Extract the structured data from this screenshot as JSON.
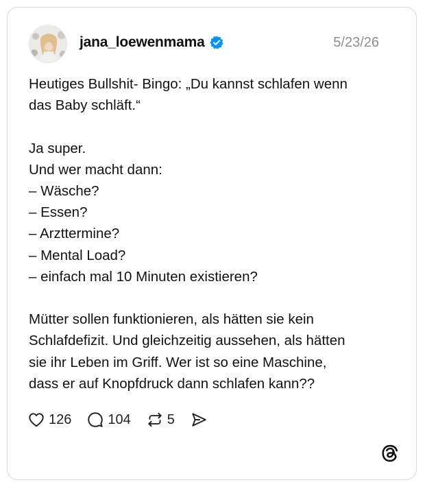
{
  "post": {
    "username": "jana_loewenmama",
    "verified_icon": "verified-badge-icon",
    "timestamp": "5/23/26",
    "lines": [
      "Heutiges Bullshit- Bingo: „Du kannst schlafen wenn",
      "das Baby schläft.“",
      "",
      "Ja super.",
      "Und wer macht dann:",
      "– Wäsche?",
      "– Essen?",
      "– Arzttermine?",
      "– Mental Load?",
      "– einfach mal 10 Minuten existieren?",
      "",
      "Mütter sollen funktionieren, als hätten sie kein",
      "Schlafdefizit. Und gleichzeitig aussehen, als hätten",
      "sie ihr Leben im Griff. Wer ist so eine Maschine,",
      "dass er auf Knopfdruck dann schlafen kann??"
    ]
  },
  "actions": {
    "likes": "126",
    "replies": "104",
    "reposts": "5",
    "icons": [
      "heart-icon",
      "comment-icon",
      "repost-icon",
      "share-icon"
    ]
  },
  "colors": {
    "verified": "#0095f6",
    "border": "#d9d9d9",
    "timestamp": "#8e8e8e",
    "text": "#111111"
  },
  "brand": {
    "logo_icon": "threads-logo-icon"
  }
}
